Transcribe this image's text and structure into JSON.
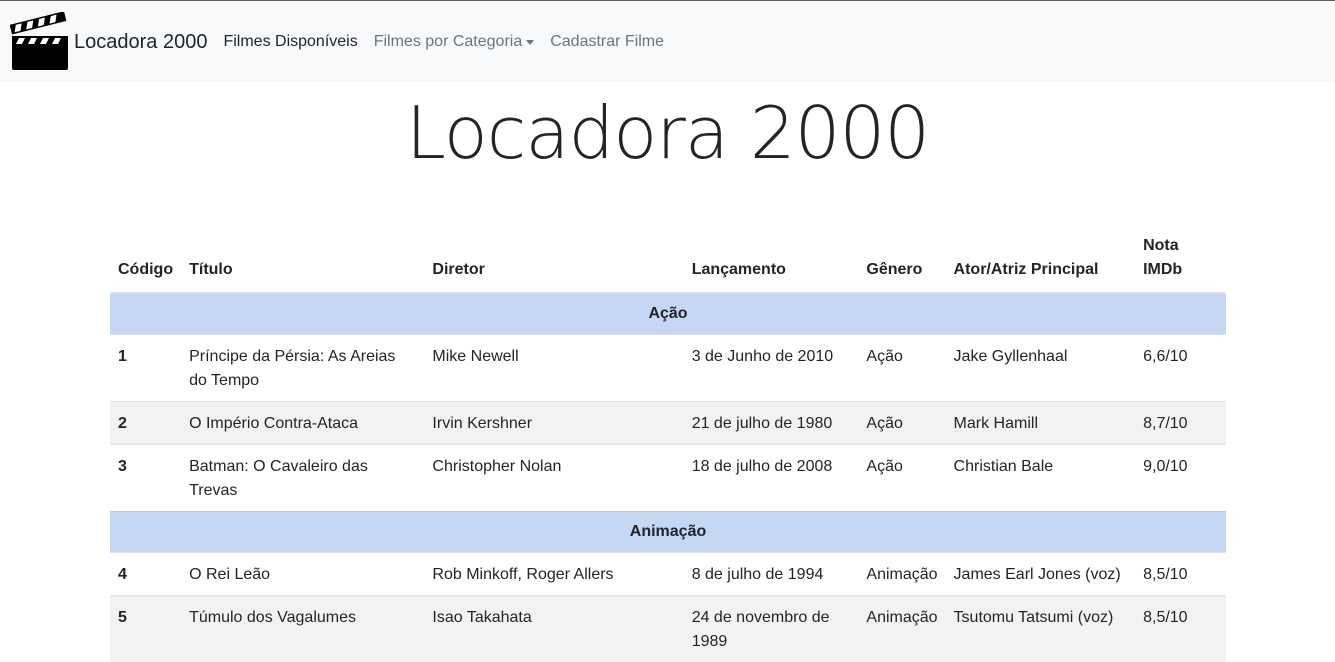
{
  "navbar": {
    "brand": "Locadora 2000",
    "links": {
      "available": "Filmes Disponíveis",
      "by_category": "Filmes por Categoria",
      "register": "Cadastrar Filme"
    }
  },
  "page": {
    "title": "Locadora 2000"
  },
  "table": {
    "headers": {
      "code": "Código",
      "title": "Título",
      "director": "Diretor",
      "release": "Lançamento",
      "genre": "Gênero",
      "actor": "Ator/Atriz Principal",
      "rating": "Nota IMDb"
    },
    "groups": [
      {
        "category": "Ação",
        "rows": [
          {
            "code": "1",
            "title": "Príncipe da Pérsia: As Areias do Tempo",
            "director": "Mike Newell",
            "release": "3 de Junho de 2010",
            "genre": "Ação",
            "actor": "Jake Gyllenhaal",
            "rating": "6,6/10"
          },
          {
            "code": "2",
            "title": "O Império Contra-Ataca",
            "director": "Irvin Kershner",
            "release": "21 de julho de 1980",
            "genre": "Ação",
            "actor": "Mark Hamill",
            "rating": "8,7/10"
          },
          {
            "code": "3",
            "title": "Batman: O Cavaleiro das Trevas",
            "director": "Christopher Nolan",
            "release": "18 de julho de 2008",
            "genre": "Ação",
            "actor": "Christian Bale",
            "rating": "9,0/10"
          }
        ]
      },
      {
        "category": "Animação",
        "rows": [
          {
            "code": "4",
            "title": "O Rei Leão",
            "director": "Rob Minkoff, Roger Allers",
            "release": "8 de julho de 1994",
            "genre": "Animação",
            "actor": "James Earl Jones (voz)",
            "rating": "8,5/10"
          },
          {
            "code": "5",
            "title": "Túmulo dos Vagalumes",
            "director": "Isao Takahata",
            "release": "24 de novembro de 1989",
            "genre": "Animação",
            "actor": "Tsutomu Tatsumi (voz)",
            "rating": "8,5/10"
          }
        ]
      }
    ]
  }
}
